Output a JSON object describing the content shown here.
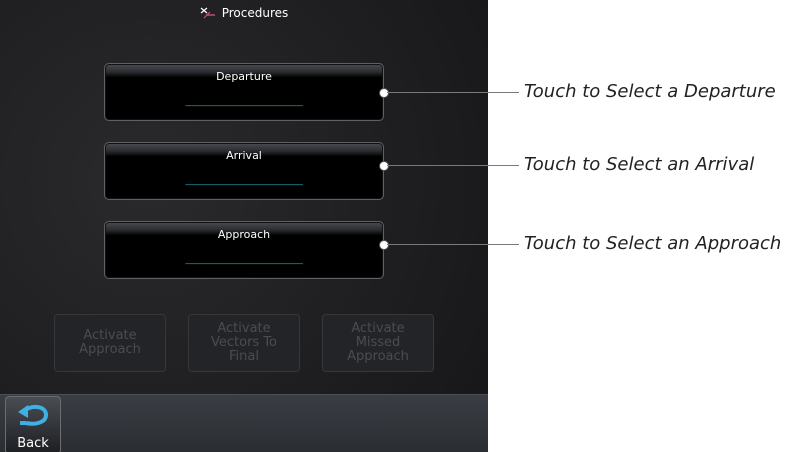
{
  "window": {
    "title": "Procedures"
  },
  "procedures": [
    {
      "label": "Departure",
      "value": "________________"
    },
    {
      "label": "Arrival",
      "value": "________________"
    },
    {
      "label": "Approach",
      "value": "________________"
    }
  ],
  "actions": [
    {
      "label": "Activate Approach"
    },
    {
      "label": "Activate Vectors To Final"
    },
    {
      "label": "Activate Missed Approach"
    }
  ],
  "back": {
    "label": "Back"
  },
  "callouts": [
    {
      "text": "Touch to Select a Departure"
    },
    {
      "text": "Touch to Select an Arrival"
    },
    {
      "text": "Touch to Select an Approach"
    }
  ],
  "colors": {
    "value_text": "#2fc7d6",
    "disabled_text": "#4b4c50"
  }
}
